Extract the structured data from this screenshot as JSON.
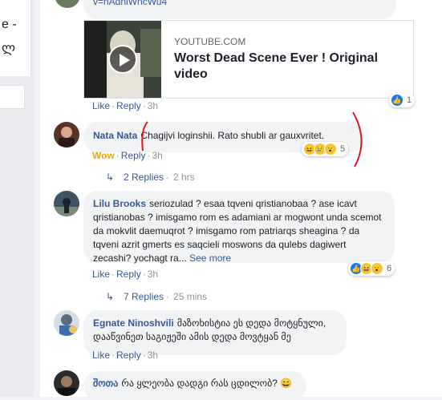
{
  "left_panel": {
    "text_1": "e -",
    "text_2": "ლ"
  },
  "top_comment": {
    "url_tail": "v=nAdniWncWu4",
    "card": {
      "domain": "YOUTUBE.COM",
      "title": "Worst Dead Scene Ever ! Original video"
    },
    "actions": {
      "like": "Like",
      "reply": "Reply",
      "time": "3h"
    },
    "reactions": {
      "count": "1"
    }
  },
  "comments": [
    {
      "author": "Nata Nata",
      "text": "Chagijvi loginshii. Rato shubli ar gauxvritet.",
      "actions": {
        "reaction": "Wow",
        "reply": "Reply",
        "time": "3h"
      },
      "reactions": {
        "count": "5"
      },
      "replies": {
        "label": "2 Replies",
        "time": "2 hrs"
      }
    },
    {
      "author": "Lilu Brooks",
      "text": "seriozulad ? esaa tqveni qristianobaa ? ase icavt qristianobas ? imisgamo rom es adamiani ar mogwont unda scemot da mokvlit daemuqrot ? imisgamo rom patriarqs sheagina ? da tqveni azrit gmerts es saqcieli moswons da qulebs dagiwert zecashi? yochagt ra...",
      "see_more": "See more",
      "actions": {
        "like": "Like",
        "reply": "Reply",
        "time": "3h"
      },
      "reactions": {
        "count": "6"
      },
      "replies": {
        "label": "7 Replies",
        "time": "25 mins"
      }
    },
    {
      "author": "Egnate Ninoshvili",
      "text": "მაზოხისტია ეს დედა მოტყნული, დააწვინეთ საგიჟეში ამის დედა მოვტყან მე",
      "actions": {
        "like": "Like",
        "reply": "Reply",
        "time": "3h"
      }
    },
    {
      "author": "შოთა",
      "text": "რა ყლეობა დადგი რას ცდილობ?",
      "emoji": "😄"
    }
  ],
  "colors": {
    "link": "#385898",
    "annotation": "#e0141e"
  }
}
